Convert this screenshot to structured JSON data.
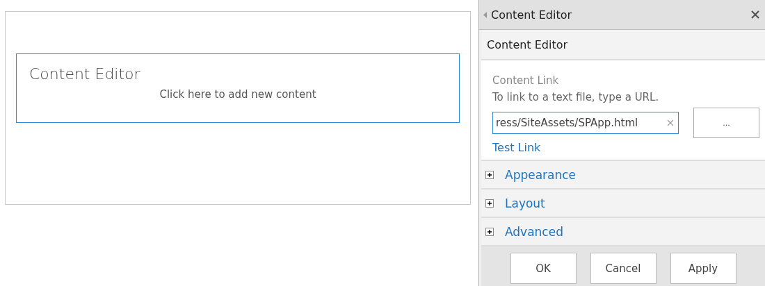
{
  "web_part": {
    "title": "Content Editor",
    "prompt": "Click here to add new content",
    "selected": true
  },
  "tool_pane": {
    "title": "Content Editor",
    "section_title": "Content Editor",
    "content_link": {
      "label": "Content Link",
      "hint": "To link to a text file, type a URL.",
      "value": "ress/SiteAssets/SPApp.html",
      "browse_label": "...",
      "test_link": "Test Link"
    },
    "sections": [
      {
        "label": "Appearance",
        "expanded": false
      },
      {
        "label": "Layout",
        "expanded": false
      },
      {
        "label": "Advanced",
        "expanded": false
      }
    ],
    "buttons": [
      "OK",
      "Cancel",
      "Apply"
    ]
  }
}
